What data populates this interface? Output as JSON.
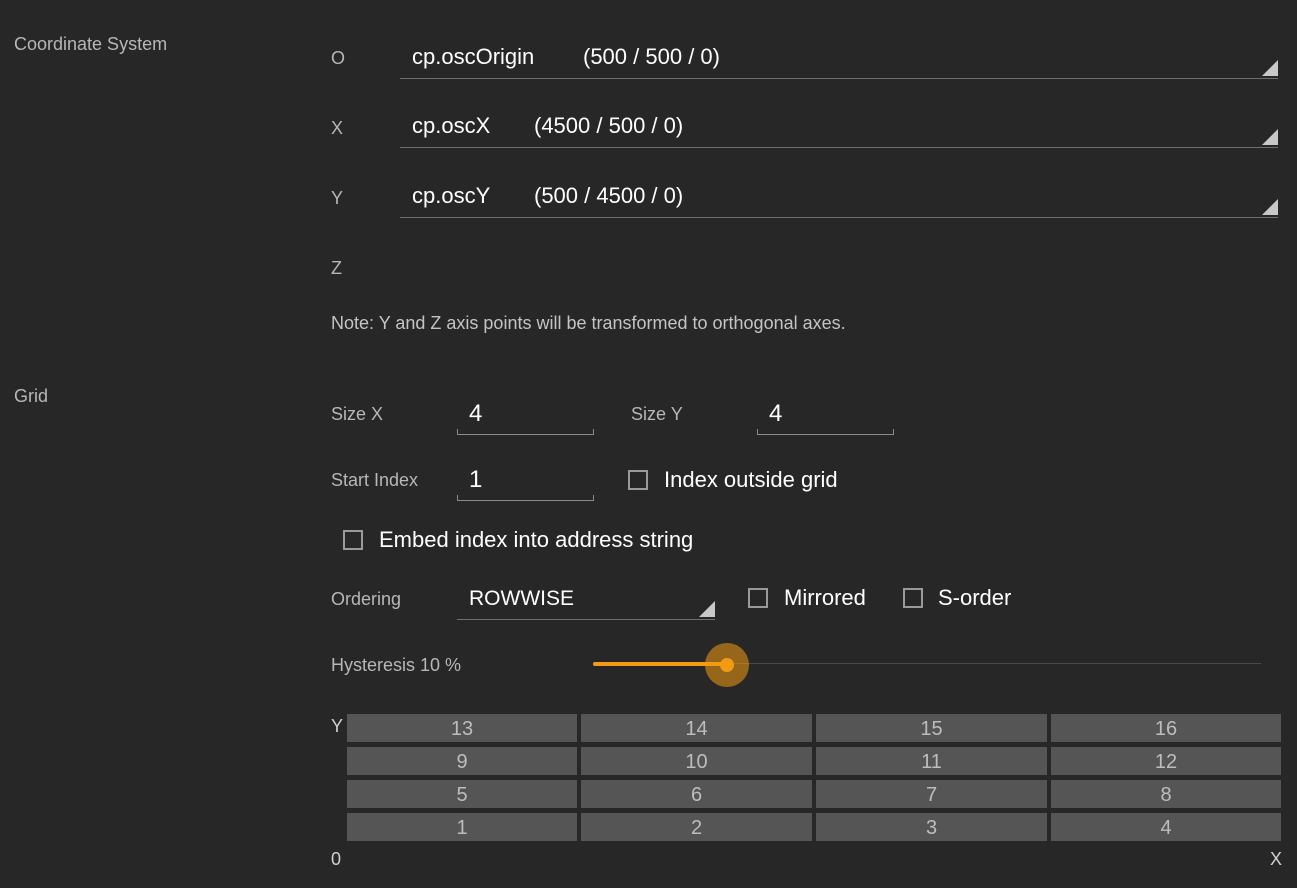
{
  "coordinate_system": {
    "label": "Coordinate System",
    "axes": [
      {
        "letter": "O",
        "name": "cp.oscOrigin",
        "coords": "(500 / 500 / 0)"
      },
      {
        "letter": "X",
        "name": "cp.oscX",
        "coords": "(4500 / 500 / 0)"
      },
      {
        "letter": "Y",
        "name": "cp.oscY",
        "coords": "(500 / 4500 / 0)"
      },
      {
        "letter": "Z"
      }
    ],
    "note": "Note: Y and Z axis points will be transformed to orthogonal axes."
  },
  "grid": {
    "label": "Grid",
    "size_x_label": "Size X",
    "size_x": "4",
    "size_y_label": "Size Y",
    "size_y": "4",
    "start_index_label": "Start Index",
    "start_index": "1",
    "index_outside_grid_label": "Index outside grid",
    "index_outside_grid_checked": false,
    "embed_index_label": "Embed index into address string",
    "embed_index_checked": false,
    "ordering_label": "Ordering",
    "ordering_value": "ROWWISE",
    "mirrored_label": "Mirrored",
    "mirrored_checked": false,
    "s_order_label": "S-order",
    "s_order_checked": false,
    "hysteresis_label": "Hysteresis 10 %",
    "hysteresis_fraction": 0.2,
    "preview": {
      "y_label": "Y",
      "origin_label": "0",
      "x_label": "X",
      "rows": [
        [
          "13",
          "14",
          "15",
          "16"
        ],
        [
          "9",
          "10",
          "11",
          "12"
        ],
        [
          "5",
          "6",
          "7",
          "8"
        ],
        [
          "1",
          "2",
          "3",
          "4"
        ]
      ]
    }
  },
  "colors": {
    "background": "#272727",
    "accent": "#f29b12",
    "cell": "#555555"
  }
}
